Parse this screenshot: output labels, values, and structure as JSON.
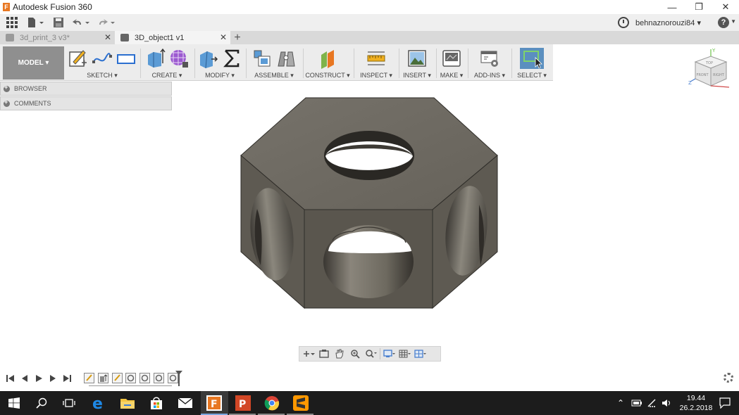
{
  "window": {
    "title": "Autodesk Fusion 360",
    "controls": {
      "minimize": "—",
      "restore": "❐",
      "close": "✕"
    }
  },
  "header": {
    "user": "behnaznorouzi84 ▾",
    "help": "?"
  },
  "tabs": [
    {
      "label": "3d_print_3 v3*",
      "active": false
    },
    {
      "label": "3D_object1 v1",
      "active": true
    }
  ],
  "toolbar": {
    "workspace": "MODEL ▾",
    "groups": [
      {
        "label": "SKETCH ▾"
      },
      {
        "label": "CREATE ▾"
      },
      {
        "label": "MODIFY ▾"
      },
      {
        "label": "ASSEMBLE ▾"
      },
      {
        "label": "CONSTRUCT ▾"
      },
      {
        "label": "INSPECT ▾"
      },
      {
        "label": "INSERT ▾"
      },
      {
        "label": "MAKE ▾"
      },
      {
        "label": "ADD-INS ▾"
      },
      {
        "label": "SELECT ▾"
      }
    ]
  },
  "browser": {
    "items": [
      {
        "label": "BROWSER"
      },
      {
        "label": "COMMENTS"
      }
    ]
  },
  "viewcube": {
    "top": "TOP",
    "front": "FRONT",
    "right": "RIGHT",
    "axes": [
      "X",
      "Y",
      "Z"
    ]
  },
  "taskbar": {
    "time": "19.44",
    "date": "26.2.2018"
  },
  "colors": {
    "model_face_front": "#5b574f",
    "model_face_top": "#6f6b62",
    "accent": "#e87722",
    "taskbar": "#1c1c1c"
  }
}
